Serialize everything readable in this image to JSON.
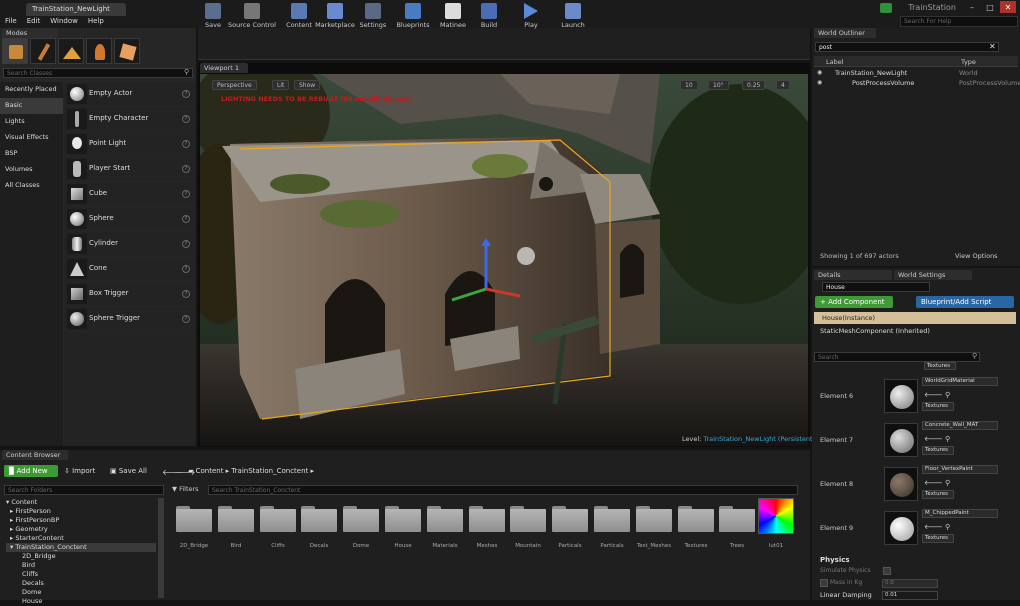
{
  "window": {
    "doc_tab": "TrainStation_NewLight",
    "project": "TrainStation",
    "help_search_placeholder": "Search For Help"
  },
  "menu": [
    "File",
    "Edit",
    "Window",
    "Help"
  ],
  "modes": {
    "tab": "Modes",
    "search_placeholder": "Search Classes",
    "categories": [
      "Recently Placed",
      "Basic",
      "Lights",
      "Visual Effects",
      "BSP",
      "Volumes",
      "All Classes"
    ],
    "selected_category": "Basic",
    "items": [
      "Empty Actor",
      "Empty Character",
      "Point Light",
      "Player Start",
      "Cube",
      "Sphere",
      "Cylinder",
      "Cone",
      "Box Trigger",
      "Sphere Trigger"
    ]
  },
  "toolbar": {
    "buttons": [
      "Save",
      "Source Control",
      "Content",
      "Marketplace",
      "Settings",
      "Blueprints",
      "Matinee",
      "Build",
      "Play",
      "Launch"
    ]
  },
  "viewport": {
    "tab": "Viewport 1",
    "view_mode": "Perspective",
    "lit": "Lit",
    "show": "Show",
    "grid_snap": "10",
    "rot_snap": "10°",
    "scale_snap": "0.25",
    "camera_speed": "4",
    "warning": "LIGHTING NEEDS TO BE REBUILT (86 unbuilt objects)",
    "level_label": "Level:",
    "level_name": "TrainStation_NewLight (Persistent)"
  },
  "outliner": {
    "tab": "World Outliner",
    "search_value": "post",
    "col_label": "Label",
    "col_type": "Type",
    "rows": [
      {
        "label": "TrainStation_NewLight",
        "type": "World"
      },
      {
        "label": "PostProcessVolume",
        "type": "PostProcessVolume"
      }
    ],
    "status": "Showing 1 of 697 actors",
    "view_options": "View Options"
  },
  "details": {
    "tab_details": "Details",
    "tab_world": "World Settings",
    "name_value": "House",
    "add_component": "+ Add Component",
    "blueprint_btn": "Blueprint/Add Script",
    "instance_label": "House(Instance)",
    "component": "StaticMeshComponent (Inherited)",
    "search_placeholder": "Search",
    "textures_label": "Textures",
    "elements": [
      {
        "label": "Element 6",
        "material": "WorldGridMaterial"
      },
      {
        "label": "Element 7",
        "material": "Concrete_Wall_MAT"
      },
      {
        "label": "Element 8",
        "material": "Floor_VertexPaint"
      },
      {
        "label": "Element 9",
        "material": "M_ChippedPaint"
      }
    ],
    "physics_header": "Physics",
    "simulate_physics": "Simulate Physics",
    "mass_label": "Mass in Kg",
    "mass_value": "0.0",
    "linear_damping": "Linear Damping",
    "linear_damping_value": "0.01"
  },
  "content_browser": {
    "tab": "Content Browser",
    "add_new": "Add New",
    "import": "Import",
    "save_all": "Save All",
    "breadcrumb": [
      "Content",
      "TrainStation_Conctent"
    ],
    "search_folders_placeholder": "Search Folders",
    "filters": "Filters",
    "search_placeholder": "Search TrainStation_Conctent",
    "tree": [
      {
        "label": "Content",
        "level": 0
      },
      {
        "label": "FirstPerson",
        "level": 1
      },
      {
        "label": "FirstPersonBP",
        "level": 1
      },
      {
        "label": "Geometry",
        "level": 1
      },
      {
        "label": "StarterContent",
        "level": 1
      },
      {
        "label": "TrainStation_Conctent",
        "level": 1
      },
      {
        "label": "2D_Bridge",
        "level": 2
      },
      {
        "label": "Bird",
        "level": 2
      },
      {
        "label": "Cliffs",
        "level": 2
      },
      {
        "label": "Decals",
        "level": 2
      },
      {
        "label": "Dome",
        "level": 2
      },
      {
        "label": "House",
        "level": 2
      }
    ],
    "folders": [
      "2D_Bridge",
      "Bird",
      "Cliffs",
      "Decals",
      "Dome",
      "House",
      "Materials",
      "Meshes",
      "Mountain",
      "Particals",
      "Particals",
      "Test_Meshes",
      "Textures",
      "Trees"
    ],
    "asset": "lut01"
  }
}
